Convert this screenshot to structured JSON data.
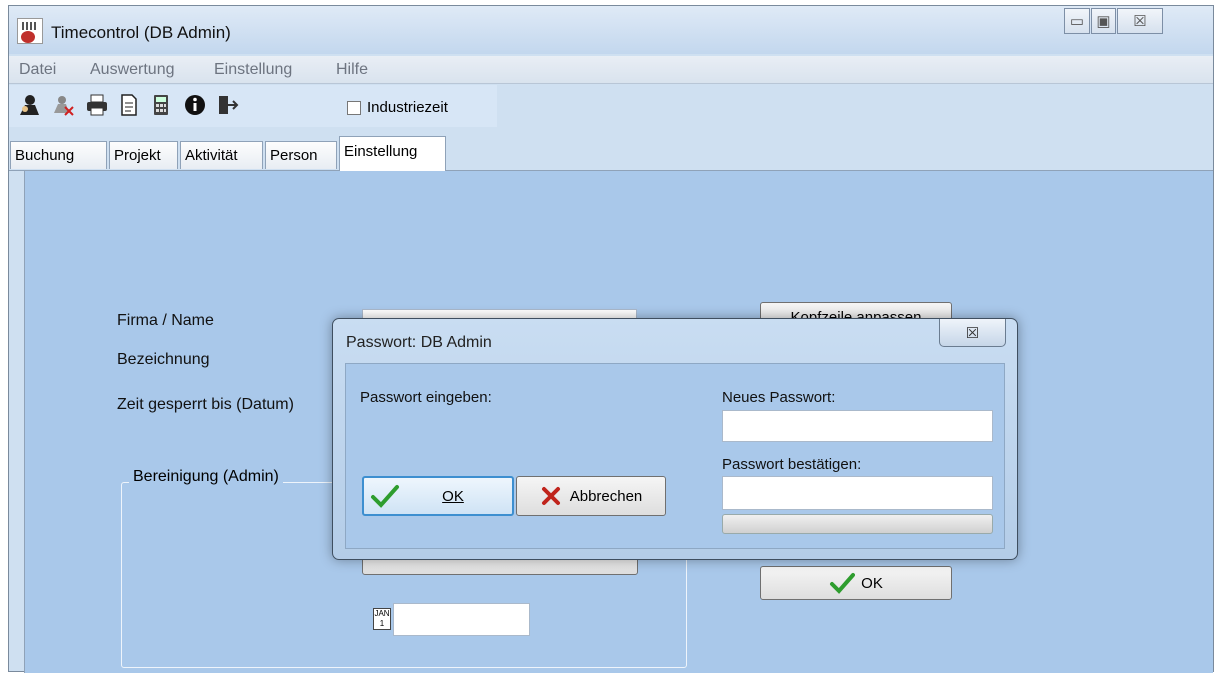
{
  "window": {
    "title": "Timecontrol (DB Admin)",
    "controls": {
      "minimize": "▭",
      "maximize": "▣",
      "close": "☒"
    }
  },
  "menu": [
    "Datei",
    "Auswertung",
    "Einstellung",
    "Hilfe"
  ],
  "toolbar": {
    "icons": [
      "user-icon",
      "user-delete-icon",
      "printer-icon",
      "document-icon",
      "calculator-icon",
      "info-icon",
      "exit-icon"
    ],
    "checkbox_label": "Industriezeit",
    "checkbox_checked": false
  },
  "tabs": [
    "Buchung",
    "Projekt",
    "Aktivität",
    "Person",
    "Einstellung"
  ],
  "active_tab": "Einstellung",
  "settings": {
    "firma_label": "Firma / Name",
    "bezeichnung_label": "Bezeichnung",
    "zeit_label": "Zeit gesperrt bis (Datum)",
    "kopfzeile_button": "Kopfzeile anpassen",
    "group_label": "Bereinigung (Admin)",
    "ok_button": "OK",
    "calendar_icon_text": "JAN 1"
  },
  "dialog": {
    "title": "Passwort: DB Admin",
    "close_glyph": "☒",
    "passwort_label": "Passwort eingeben:",
    "neues_label": "Neues Passwort:",
    "bestaetigen_label": "Passwort bestätigen:",
    "ok_button": "OK",
    "cancel_button": "Abbrechen"
  },
  "colors": {
    "content_bg": "#a9c8ea",
    "ok_check": "#2e9d2e",
    "cancel_x": "#c0241c"
  }
}
